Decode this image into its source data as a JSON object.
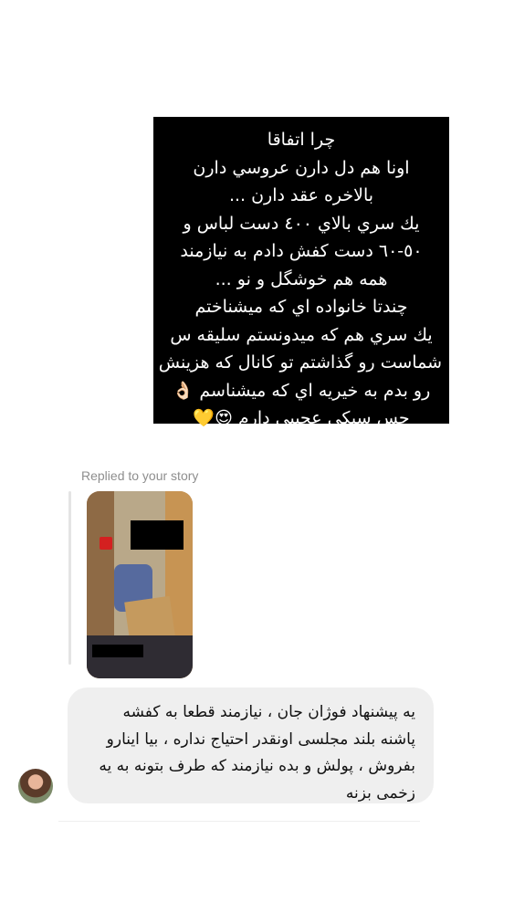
{
  "story_card": {
    "lines": [
      "چرا اتفاقا",
      "اونا هم دل دارن عروسي دارن",
      "بالاخره عقد دارن ...",
      "يك سري بالاي ٤٠٠ دست لباس و",
      "٥٠-٦٠ دست كفش دادم به نيازمند",
      "همه هم خوشگل و نو ...",
      "چندتا خانواده اي كه ميشناختم",
      "يك سري هم كه ميدونستم سليقه س",
      "شماست رو گذاشتم تو كانال كه هزينش",
      "رو بدم به خيريه اي كه ميشناسم 👌🏻",
      "حس سبكي عجيبي دارم 😍💛"
    ]
  },
  "replied_label": "Replied to your story",
  "message": {
    "lines": [
      "یه پیشنهاد فوژان جان ، نیازمند قطعا به کفشه",
      "پاشنه بلند مجلسی اونقدر احتیاج نداره ، بیا اینارو",
      "بفروش ، پولش و بده نیازمند که طرف بتونه به یه",
      "زخمی بزنه"
    ]
  },
  "colors": {
    "card_bg": "#000000",
    "bubble_bg": "#efefef",
    "muted_text": "#8e8e8e"
  }
}
